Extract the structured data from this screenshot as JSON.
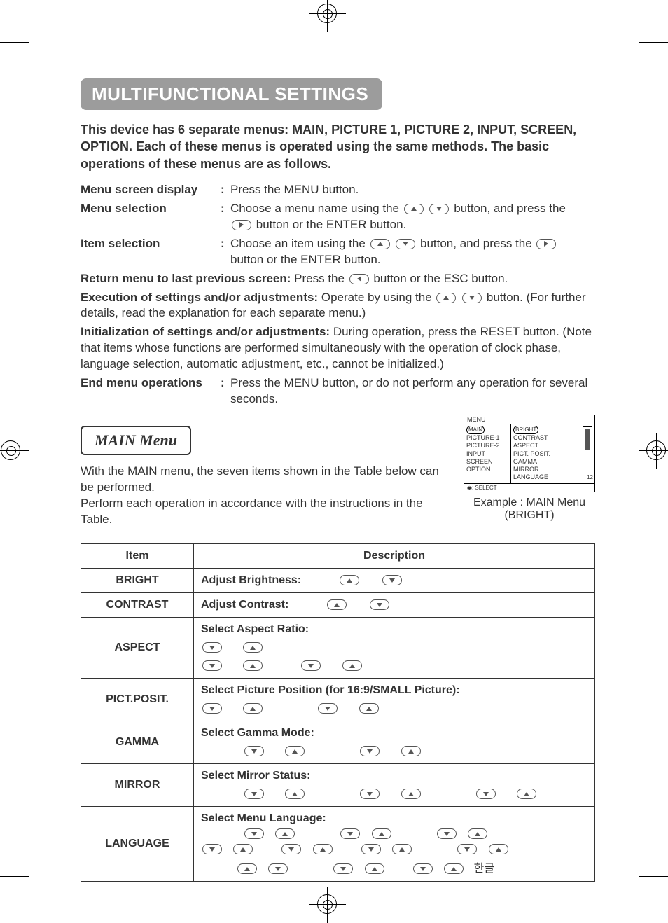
{
  "title": "MULTIFUNCTIONAL SETTINGS",
  "intro": "This device has 6 separate menus: MAIN, PICTURE 1, PICTURE 2, INPUT, SCREEN, OPTION. Each of these menus is operated using the same methods. The basic operations of these menus are as follows.",
  "defs": {
    "menu_display_label": "Menu screen display",
    "menu_display_body": "Press the  MENU  button.",
    "menu_selection_label": "Menu selection",
    "menu_selection_body_1": "Choose a menu name using the ",
    "menu_selection_body_2": " button, and press the ",
    "menu_selection_body_3": " button or the ENTER button.",
    "item_selection_label": "Item selection",
    "item_selection_body_1": "Choose an item using the ",
    "item_selection_body_2": " button, and press the ",
    "item_selection_body_3": " button or the ENTER button.",
    "return_label": "Return menu to last previous screen:",
    "return_body_1": " Press the ",
    "return_body_2": " button or the ESC button.",
    "exec_label": "Execution of settings and/or adjustments:",
    "exec_body_1": " Operate by using the ",
    "exec_body_2": " button. (For further details, read the explanation for each separate menu.)",
    "init_label": "Initialization of settings and/or adjustments:",
    "init_body": " During operation, press the RESET button. (Note that items whose functions are performed simultaneously with the operation of clock phase, language selection, automatic adjustment, etc., cannot be initialized.)",
    "end_label": "End menu operations",
    "end_body": "Press the MENU button, or do not perform any operation for several seconds."
  },
  "section": {
    "heading": "MAIN Menu",
    "text_1": "With the MAIN menu, the seven items shown in the Table below can be performed.",
    "text_2": "Perform each operation in accordance with the instructions in the Table."
  },
  "osd": {
    "title": "MENU",
    "left": [
      "MAIN",
      "PICTURE-1",
      "PICTURE-2",
      "INPUT",
      "SCREEN",
      "OPTION"
    ],
    "right": [
      "BRIGHT",
      "CONTRAST",
      "ASPECT",
      "PICT. POSIT.",
      "GAMMA",
      "MIRROR",
      "LANGUAGE"
    ],
    "value": "12",
    "foot": ": SELECT",
    "caption_1": "Example : MAIN Menu",
    "caption_2": "(BRIGHT)"
  },
  "table": {
    "header_item": "Item",
    "header_desc": "Description",
    "rows": [
      {
        "item": "BRIGHT",
        "desc": "Adjust Brightness:"
      },
      {
        "item": "CONTRAST",
        "desc": "Adjust Contrast:"
      },
      {
        "item": "ASPECT",
        "desc": "Select Aspect Ratio:"
      },
      {
        "item": "PICT.POSIT.",
        "desc": "Select Picture Position (for 16:9/SMALL Picture):"
      },
      {
        "item": "GAMMA",
        "desc": "Select Gamma Mode:"
      },
      {
        "item": "MIRROR",
        "desc": "Select Mirror Status:"
      },
      {
        "item": "LANGUAGE",
        "desc": "Select Menu Language:",
        "extra": "한글"
      }
    ]
  }
}
